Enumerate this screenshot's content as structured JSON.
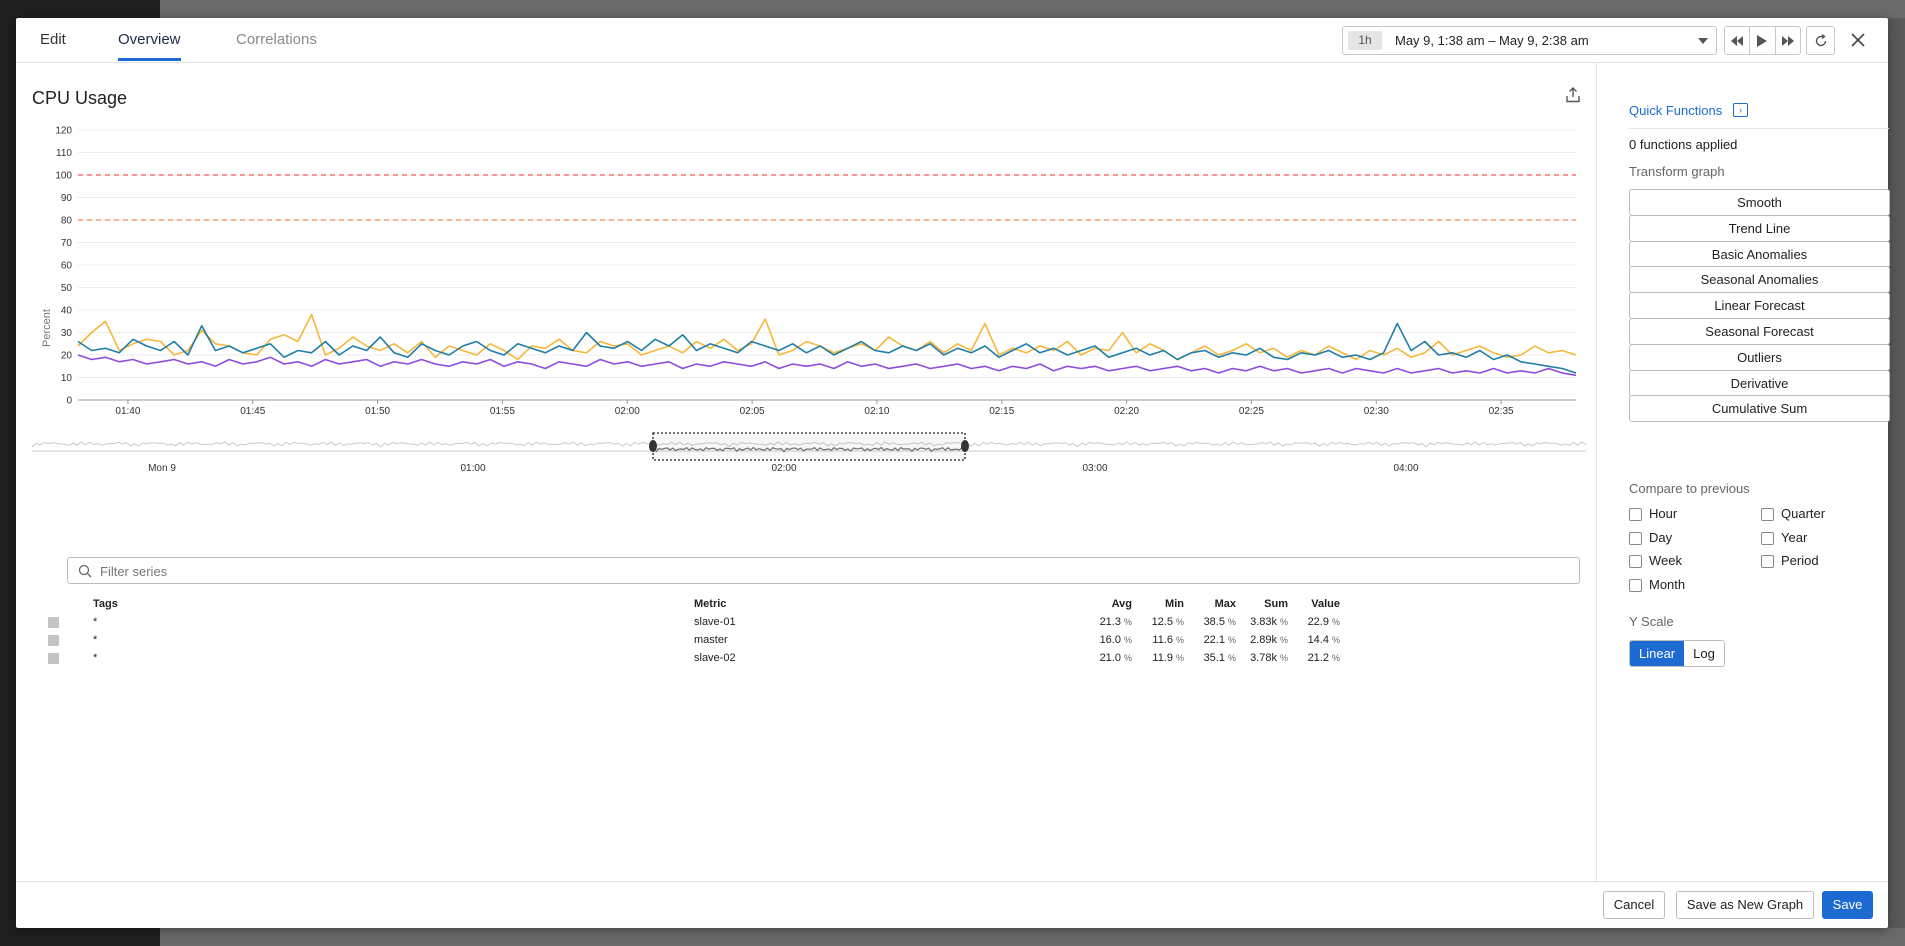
{
  "tabs": [
    {
      "label": "Edit"
    },
    {
      "label": "Overview"
    },
    {
      "label": "Correlations"
    }
  ],
  "time": {
    "badge": "1h",
    "range": "May 9, 1:38 am – May 9, 2:38 am"
  },
  "graph": {
    "title": "CPU Usage"
  },
  "filter": {
    "placeholder": "Filter series"
  },
  "legend": {
    "headers": {
      "tags": "Tags",
      "metric": "Metric",
      "avg": "Avg",
      "min": "Min",
      "max": "Max",
      "sum": "Sum",
      "value": "Value"
    },
    "unit": "%",
    "rows": [
      {
        "tags": "*",
        "metric": "slave-01",
        "avg": "21.3",
        "min": "12.5",
        "max": "38.5",
        "sum": "3.83k",
        "value": "22.9"
      },
      {
        "tags": "*",
        "metric": "master",
        "avg": "16.0",
        "min": "11.6",
        "max": "22.1",
        "sum": "2.89k",
        "value": "14.4"
      },
      {
        "tags": "*",
        "metric": "slave-02",
        "avg": "21.0",
        "min": "11.9",
        "max": "35.1",
        "sum": "3.78k",
        "value": "21.2"
      }
    ]
  },
  "sidebar": {
    "quick_functions": "Quick Functions",
    "applied": "0 functions applied",
    "transform_label": "Transform graph",
    "functions": [
      "Smooth",
      "Trend Line",
      "Basic Anomalies",
      "Seasonal Anomalies",
      "Linear Forecast",
      "Seasonal Forecast",
      "Outliers",
      "Derivative",
      "Cumulative Sum"
    ],
    "compare_label": "Compare to previous",
    "compare": [
      {
        "label": "Hour"
      },
      {
        "label": "Quarter"
      },
      {
        "label": "Day"
      },
      {
        "label": "Year"
      },
      {
        "label": "Week"
      },
      {
        "label": "Period"
      },
      {
        "label": "Month"
      }
    ],
    "yscale_label": "Y Scale",
    "yscale": [
      {
        "label": "Linear",
        "active": true
      },
      {
        "label": "Log",
        "active": false
      }
    ]
  },
  "footer": {
    "cancel": "Cancel",
    "save_new": "Save as New Graph",
    "save": "Save"
  },
  "colors": {
    "accent": "#1d6ad2",
    "slave_01": "#f6b73c",
    "master": "#8d4ce0",
    "slave_02": "#1f7ea8",
    "threshold_critical": "#f05a5a",
    "threshold_warning": "#f08a4a"
  },
  "chart_data": {
    "type": "line",
    "ylabel": "Percent",
    "ylim": [
      0,
      120
    ],
    "yticks": [
      "0",
      "10",
      "20",
      "30",
      "40",
      "50",
      "60",
      "70",
      "80",
      "90",
      "100",
      "110",
      "120"
    ],
    "xticks": [
      "01:40",
      "01:45",
      "01:50",
      "01:55",
      "02:00",
      "02:05",
      "02:10",
      "02:15",
      "02:20",
      "02:25",
      "02:30",
      "02:35"
    ],
    "xrange": [
      "01:38",
      "02:38"
    ],
    "thresholds": [
      {
        "value": 100,
        "color": "#f05a5a"
      },
      {
        "value": 80,
        "color": "#f08a4a"
      }
    ],
    "navigator_ticks": [
      "Mon 9",
      "01:00",
      "02:00",
      "03:00",
      "04:00"
    ],
    "series": [
      {
        "name": "slave-01",
        "color": "#f6b73c",
        "values": [
          24,
          30,
          35,
          22,
          25,
          27,
          26,
          20,
          22,
          31,
          25,
          24,
          21,
          20,
          27,
          29,
          26,
          38,
          20,
          23,
          28,
          24,
          22,
          25,
          21,
          26,
          19,
          24,
          22,
          20,
          25,
          22,
          18,
          24,
          23,
          27,
          22,
          21,
          26,
          24,
          25,
          20,
          22,
          24,
          21,
          26,
          23,
          27,
          22,
          25,
          36,
          20,
          22,
          26,
          24,
          21,
          23,
          25,
          22,
          28,
          24,
          22,
          26,
          21,
          25,
          22,
          34,
          20,
          23,
          21,
          24,
          22,
          26,
          20,
          23,
          22,
          30,
          21,
          25,
          22,
          18,
          21,
          24,
          20,
          22,
          25,
          21,
          23,
          19,
          22,
          20,
          24,
          21,
          18,
          22,
          20,
          23,
          19,
          21,
          26,
          20,
          22,
          24,
          21,
          19,
          20,
          24,
          21,
          22,
          20
        ]
      },
      {
        "name": "master",
        "color": "#8d4ce0",
        "values": [
          20,
          18,
          19,
          17,
          18,
          16,
          17,
          18,
          16,
          17,
          15,
          18,
          16,
          17,
          19,
          16,
          17,
          15,
          18,
          16,
          17,
          18,
          15,
          17,
          16,
          18,
          16,
          15,
          17,
          16,
          18,
          15,
          17,
          16,
          14,
          17,
          16,
          15,
          18,
          16,
          17,
          15,
          16,
          17,
          14,
          16,
          15,
          17,
          16,
          15,
          17,
          14,
          16,
          15,
          16,
          14,
          17,
          15,
          16,
          14,
          15,
          16,
          14,
          15,
          16,
          14,
          15,
          13,
          15,
          14,
          16,
          13,
          15,
          14,
          15,
          13,
          14,
          15,
          13,
          14,
          15,
          13,
          14,
          12,
          14,
          13,
          15,
          13,
          14,
          12,
          13,
          14,
          12,
          14,
          13,
          12,
          14,
          12,
          13,
          14,
          12,
          13,
          12,
          14,
          12,
          13,
          12,
          14,
          12,
          11
        ]
      },
      {
        "name": "slave-02",
        "color": "#1f7ea8",
        "values": [
          26,
          22,
          23,
          21,
          27,
          24,
          22,
          26,
          20,
          33,
          22,
          24,
          21,
          23,
          25,
          19,
          22,
          21,
          26,
          20,
          24,
          22,
          28,
          21,
          19,
          25,
          22,
          20,
          24,
          26,
          22,
          20,
          25,
          23,
          21,
          24,
          22,
          30,
          24,
          23,
          26,
          22,
          27,
          24,
          29,
          22,
          25,
          23,
          21,
          26,
          24,
          22,
          25,
          21,
          24,
          20,
          23,
          26,
          22,
          21,
          24,
          22,
          25,
          20,
          23,
          21,
          24,
          19,
          22,
          25,
          21,
          23,
          20,
          22,
          24,
          19,
          21,
          23,
          20,
          22,
          18,
          21,
          22,
          19,
          21,
          20,
          23,
          19,
          18,
          21,
          20,
          22,
          19,
          20,
          18,
          21,
          34,
          22,
          26,
          20,
          21,
          19,
          22,
          18,
          20,
          17,
          16,
          15,
          14,
          12
        ]
      }
    ]
  }
}
